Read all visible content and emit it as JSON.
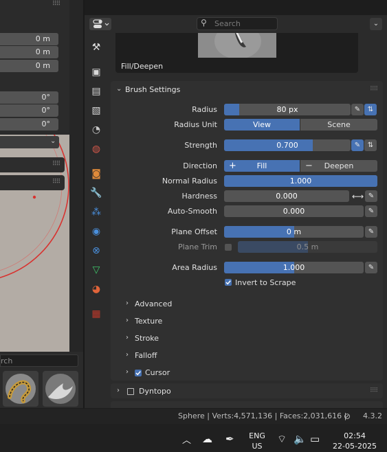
{
  "viewport": {
    "location_values": [
      "0 m",
      "0 m",
      "0 m"
    ],
    "rotation_values": [
      "0°",
      "0°",
      "0°"
    ],
    "asset_search_placeholder": "rch"
  },
  "header": {
    "search_placeholder": "Search"
  },
  "brush": {
    "name": "Fill/Deepen"
  },
  "brush_settings": {
    "title": "Brush Settings",
    "radius": {
      "label": "Radius",
      "value": "80 px",
      "fill": 0.12
    },
    "radius_unit": {
      "label": "Radius Unit",
      "options": [
        "View",
        "Scene"
      ],
      "selected": "View"
    },
    "strength": {
      "label": "Strength",
      "value": "0.700",
      "fill": 0.7
    },
    "direction": {
      "label": "Direction",
      "options": [
        "Fill",
        "Deepen"
      ],
      "selected": "Fill",
      "plus": "+",
      "minus": "−"
    },
    "normal_radius": {
      "label": "Normal Radius",
      "value": "1.000",
      "fill": 1.0
    },
    "hardness": {
      "label": "Hardness",
      "value": "0.000",
      "fill": 0.0
    },
    "auto_smooth": {
      "label": "Auto-Smooth",
      "value": "0.000",
      "fill": 0.0
    },
    "plane_offset": {
      "label": "Plane Offset",
      "value": "0 m",
      "fill": 0.5
    },
    "plane_trim": {
      "label": "Plane Trim",
      "value": "0.5 m",
      "fill": 0.5
    },
    "area_radius": {
      "label": "Area Radius",
      "value": "1.000",
      "fill": 0.5
    },
    "invert_to_scrape": {
      "label": "Invert to Scrape",
      "checked": true
    }
  },
  "subpanels": [
    "Advanced",
    "Texture",
    "Stroke",
    "Falloff"
  ],
  "cursor": {
    "label": "Cursor",
    "checked": true
  },
  "dyntopo": {
    "label": "Dyntopo",
    "checked": false
  },
  "status": {
    "text": "Sphere | Verts:4,571,136 | Faces:2,031,616 |",
    "version": "4.3.2"
  },
  "taskbar": {
    "lang_line1": "ENG",
    "lang_line2": "US",
    "time": "02:54",
    "date": "22-05-2025"
  },
  "colors": {
    "accent": "#4772b3",
    "panel": "#303030",
    "field": "#545454"
  }
}
